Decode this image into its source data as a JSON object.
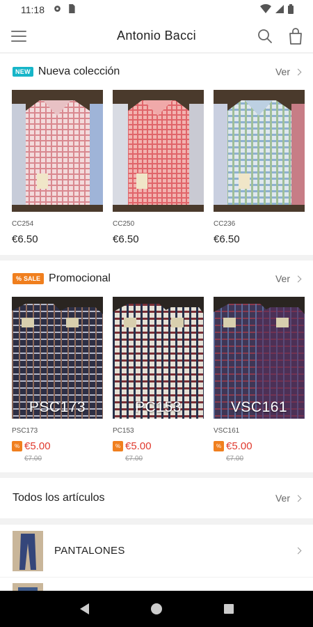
{
  "status": {
    "time": "11:18"
  },
  "header": {
    "title": "Antonio Bacci"
  },
  "sections": {
    "new": {
      "badge": "NEW",
      "title": "Nueva colección",
      "see_all": "Ver",
      "items": [
        {
          "code": "CC254",
          "price": "€6.50",
          "color": "#d9888f"
        },
        {
          "code": "CC250",
          "price": "€6.50",
          "color": "#e0656a"
        },
        {
          "code": "CC236",
          "price": "€6.50",
          "color": "#8fb1cf"
        }
      ]
    },
    "promo": {
      "badge": "SALE",
      "title": "Promocional",
      "see_all": "Ver",
      "items": [
        {
          "code": "PSC173",
          "overlay": "PSC173",
          "sale_price": "€5.00",
          "old_price": "€7.00",
          "color": "#3f3a5a"
        },
        {
          "code": "PC153",
          "overlay": "PC153",
          "sale_price": "€5.00",
          "old_price": "€7.00",
          "color": "#7a2f36"
        },
        {
          "code": "VSC161",
          "overlay": "VSC161",
          "sale_price": "€5.00",
          "old_price": "€7.00",
          "color": "#5a2a55"
        }
      ]
    },
    "all": {
      "title": "Todos los artículos",
      "see_all": "Ver",
      "categories": [
        {
          "label": "PANTALONES"
        }
      ]
    }
  },
  "icons": {
    "menu": "menu-icon",
    "search": "search-icon",
    "cart": "shopping-bag-icon"
  }
}
